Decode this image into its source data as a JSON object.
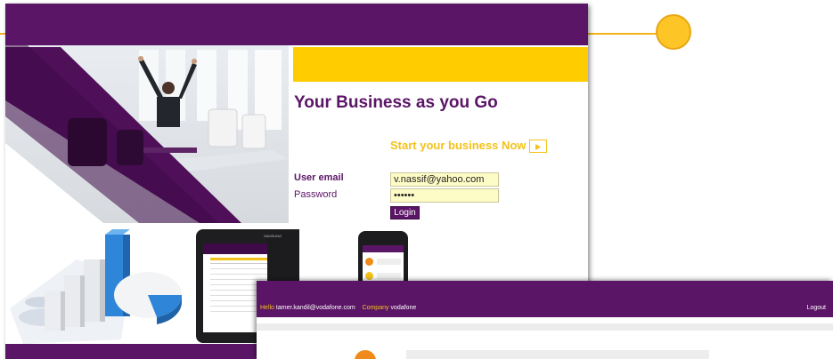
{
  "colors": {
    "brand_purple": "#5b1566",
    "brand_yellow": "#ffcc00",
    "accent_orange": "#f3c21a"
  },
  "login": {
    "headline": "Your Business as you Go",
    "start_link": "Start your business Now",
    "email_label": "User email",
    "email_value": "v.nassif@yahoo.com",
    "password_label": "Password",
    "password_value": "••••••",
    "login_button": "Login"
  },
  "device": {
    "tablet_brand": "SAMSUNG"
  },
  "dashboard": {
    "hello_label": "Hello",
    "user_email": "tamer.kandil@vodafone.com",
    "company_label": "Company",
    "company_name": "vodafone",
    "logout": "Logout"
  }
}
